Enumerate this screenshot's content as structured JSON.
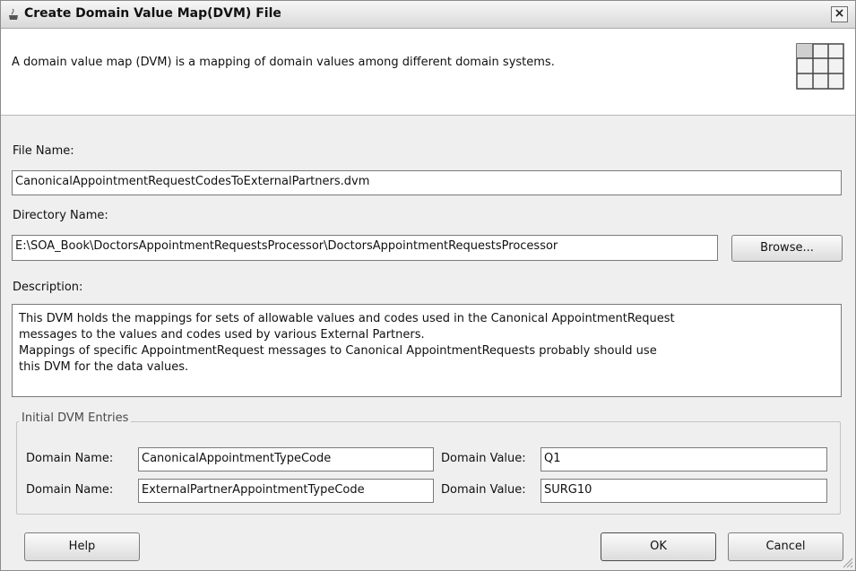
{
  "window": {
    "title": "Create Domain Value Map(DVM) File",
    "close_icon": "close-icon",
    "title_icon": "oracle-cup-icon"
  },
  "header": {
    "description": "A domain value map (DVM) is a mapping of domain values among different domain systems.",
    "icon": "grid-table-icon"
  },
  "form": {
    "file_name_label": "File Name:",
    "file_name_value": "CanonicalAppointmentRequestCodesToExternalPartners.dvm",
    "directory_label": "Directory Name:",
    "directory_value": "E:\\SOA_Book\\DoctorsAppointmentRequestsProcessor\\DoctorsAppointmentRequestsProcessor",
    "browse_label": "Browse...",
    "description_label": "Description:",
    "description_lines": [
      "This DVM holds the mappings for sets of allowable values and codes used in the Canonical AppointmentRequest",
      "messages to the values and codes used by various External Partners.",
      "Mappings of specific AppointmentRequest messages to Canonical AppointmentRequests probably should use",
      "this DVM for the data values."
    ]
  },
  "entries": {
    "group_label": "Initial DVM Entries",
    "rows": [
      {
        "domain_name_label": "Domain Name:",
        "domain_name_value": "CanonicalAppointmentTypeCode",
        "domain_value_label": "Domain Value:",
        "domain_value_value": "Q1"
      },
      {
        "domain_name_label": "Domain Name:",
        "domain_name_value": "ExternalPartnerAppointmentTypeCode",
        "domain_value_label": "Domain Value:",
        "domain_value_value": "SURG10"
      }
    ]
  },
  "buttons": {
    "help": "Help",
    "ok": "OK",
    "cancel": "Cancel"
  }
}
